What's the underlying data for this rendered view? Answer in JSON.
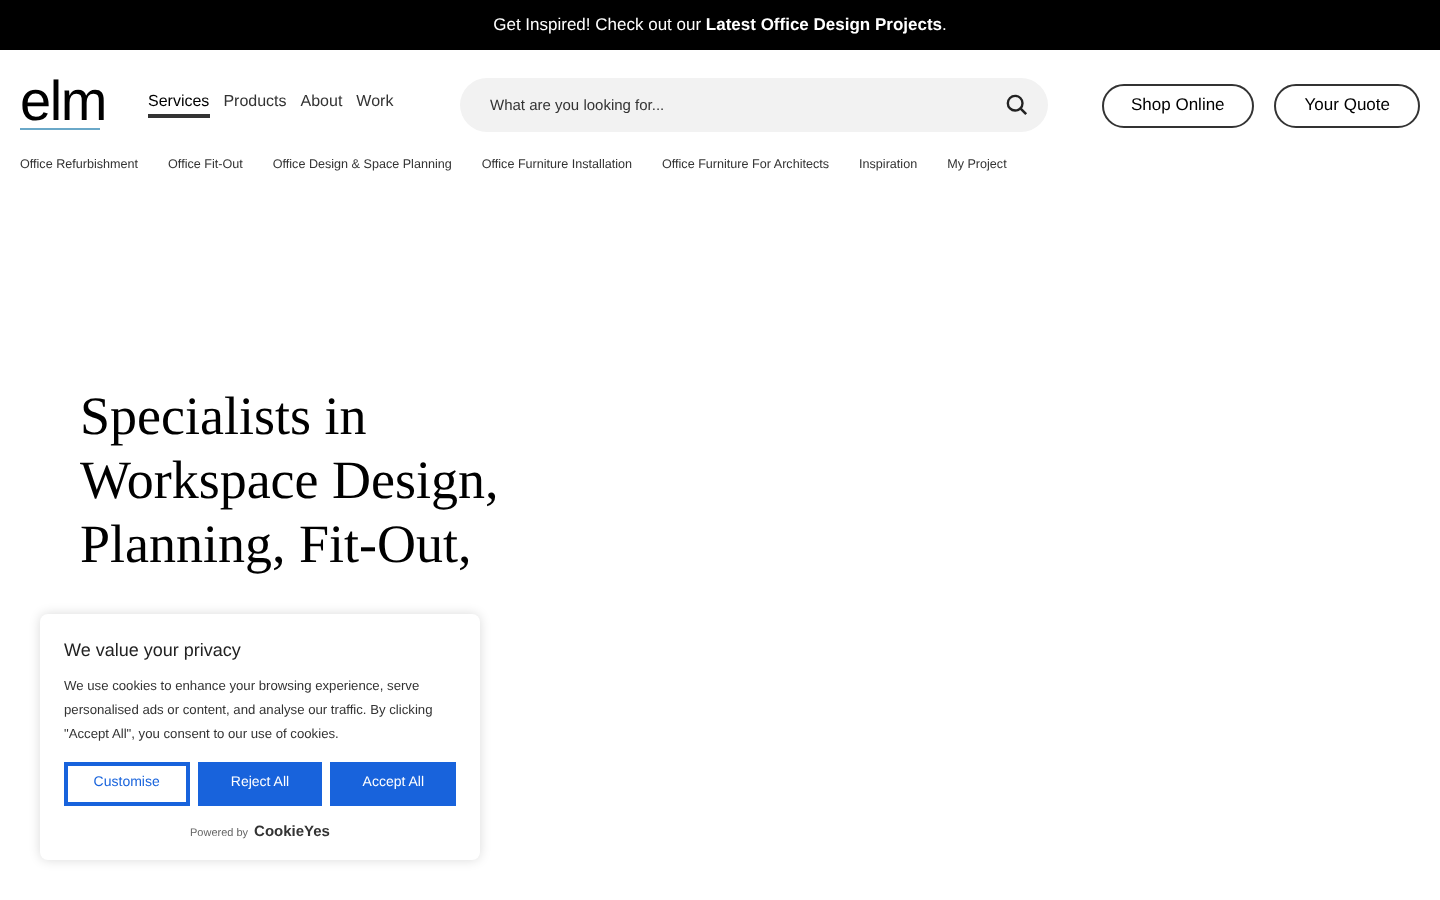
{
  "announcement": {
    "text": "Get Inspired! Check out our **Latest Office Design Projects**."
  },
  "logo": {
    "text": "elm"
  },
  "nav": [
    {
      "label": "Services",
      "selected": true
    },
    {
      "label": "Products",
      "selected": false
    },
    {
      "label": "About",
      "selected": false
    },
    {
      "label": "Work",
      "selected": false
    }
  ],
  "search": {
    "placeholder": "What are you looking for..."
  },
  "header_buttons": [
    "Shop Online",
    "Your Quote"
  ],
  "subnav": [
    "Office Refurbishment",
    "Office Fit-Out",
    "Office Design & Space Planning",
    "Office Furniture Installation",
    "Office Furniture For Architects",
    "Inspiration",
    "My Project"
  ],
  "hero": {
    "heading": "Specialists in Workspace Design, Planning, Fit-Out,"
  },
  "cookie_banner": {
    "title": "We value your privacy",
    "text": "We use cookies to enhance your browsing experience, serve personalised ads or content, and analyse our traffic. By clicking \"Accept All\", you consent to our use of cookies.",
    "buttons": [
      {
        "label": "Customise",
        "kind": "outline"
      },
      {
        "label": "Reject All",
        "kind": "solid"
      },
      {
        "label": "Accept All",
        "kind": "solid"
      }
    ],
    "powered_by": "Powered by",
    "brand": "CookieYes"
  }
}
